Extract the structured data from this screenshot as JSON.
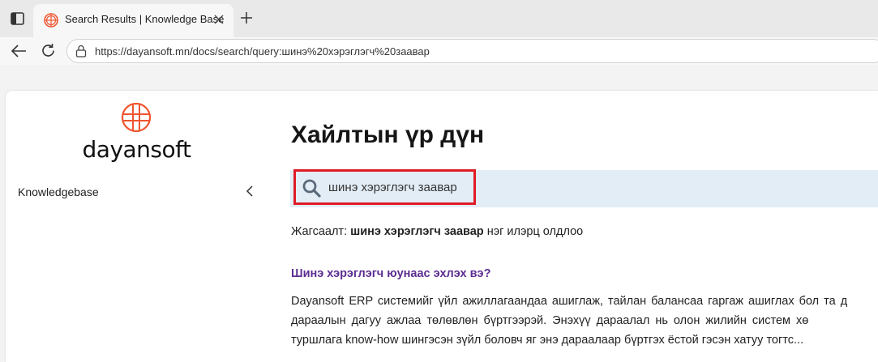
{
  "browser": {
    "tab": {
      "title": "Search Results | Knowledge Base"
    },
    "address": {
      "url": "https://dayansoft.mn/docs/search/query:шинэ%20хэрэглэгч%20заавар"
    }
  },
  "sidebar": {
    "logo_text": "dayansoft",
    "items": [
      {
        "label": "Knowledgebase"
      }
    ]
  },
  "main": {
    "title": "Хайлтын үр дүн",
    "search": {
      "value": "шинэ хэрэглэгч заавар"
    },
    "summary": {
      "prefix": "Жагсаалт:",
      "query": "шинэ хэрэглэгч заавар",
      "suffix": "нэг илэрц олдлоо"
    },
    "results": [
      {
        "title": "Шинэ хэрэглэгч юунаас эхлэх вэ?",
        "excerpt_lines": [
          "Dayansoft ERP системийг үйл ажиллагаандаа ашиглаж, тайлан балансаа гаргаж ашиглах бол та д",
          "дараалын дагуу ажлаа төлөвлөн бүртгээрэй. Энэхүү дараалал нь олон жилийн систем хө",
          "туршлага know-how шингэсэн зүйл боловч яг энэ дараалаар бүртгэх ёстой гэсэн хатуу тогтс..."
        ]
      }
    ]
  },
  "colors": {
    "brand_orange": "#f0552f",
    "highlight_red": "#e01b24",
    "link_purple": "#5c2d91",
    "search_band": "#e3edf6"
  },
  "icons": [
    "sidebar-toggle-icon",
    "globe-favicon-icon",
    "close-icon",
    "plus-icon",
    "back-arrow-icon",
    "reload-icon",
    "lock-icon",
    "search-icon",
    "chevron-left-icon"
  ]
}
